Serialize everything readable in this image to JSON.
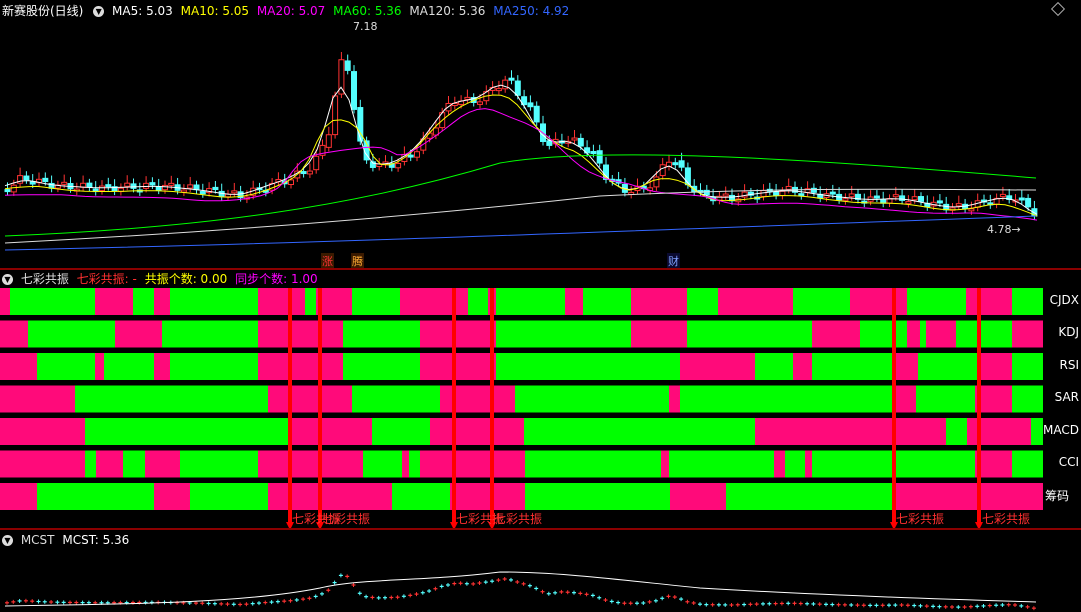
{
  "main": {
    "stock_name": "新赛股份(日线)",
    "ma": [
      {
        "label": "MA5: 5.03",
        "color": "#ffffff"
      },
      {
        "label": "MA10: 5.05",
        "color": "#ffff00"
      },
      {
        "label": "MA20: 5.07",
        "color": "#ff00ff"
      },
      {
        "label": "MA60: 5.36",
        "color": "#00ff00"
      },
      {
        "label": "MA120: 5.36",
        "color": "#dddddd"
      },
      {
        "label": "MA250: 4.92",
        "color": "#3366ff"
      }
    ],
    "high_label": "7.18",
    "low_label": "4.78→",
    "tags": [
      "涨",
      "腾",
      "财"
    ]
  },
  "qicai": {
    "name": "七彩共振",
    "s1": "七彩共振: -",
    "s2": "共振个数: 0.00",
    "s3": "同步个数: 1.00",
    "rows": [
      "CJDX",
      "KDJ",
      "RSI",
      "SAR",
      "MACD",
      "CCI",
      "筹码"
    ],
    "signals": [
      "七彩共振",
      "七彩共振",
      "七彩共振",
      "七彩共振",
      "七彩共振",
      "七彩共振"
    ]
  },
  "mcst": {
    "name": "MCST",
    "value": "MCST: 5.36"
  },
  "colors": {
    "up": "#ff3333",
    "down": "#54ffff",
    "green": "#00ff00",
    "pink": "#ff0a7a"
  }
}
